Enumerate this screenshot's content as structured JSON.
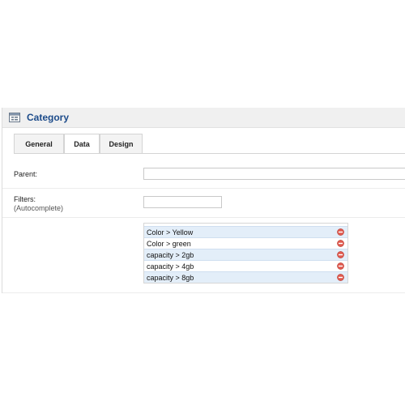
{
  "header": {
    "title": "Category",
    "icon": "category-list-icon"
  },
  "tabs": [
    {
      "label": "General",
      "active": false
    },
    {
      "label": "Data",
      "active": true
    },
    {
      "label": "Design",
      "active": false
    }
  ],
  "form": {
    "parent": {
      "label": "Parent:",
      "value": ""
    },
    "filters": {
      "label": "Filters:",
      "sublabel": "(Autocomplete)",
      "value": ""
    }
  },
  "filter_list": {
    "items": [
      {
        "label": "Color > Yellow",
        "remove_icon": "remove-circle-icon"
      },
      {
        "label": "Color > green",
        "remove_icon": "remove-circle-icon"
      },
      {
        "label": "capacity > 2gb",
        "remove_icon": "remove-circle-icon"
      },
      {
        "label": "capacity > 4gb",
        "remove_icon": "remove-circle-icon"
      },
      {
        "label": "capacity > 8gb",
        "remove_icon": "remove-circle-icon"
      }
    ]
  },
  "colors": {
    "title": "#1c4b8a",
    "row_highlight": "#e3eef9",
    "remove_icon": "#e05a4f"
  }
}
